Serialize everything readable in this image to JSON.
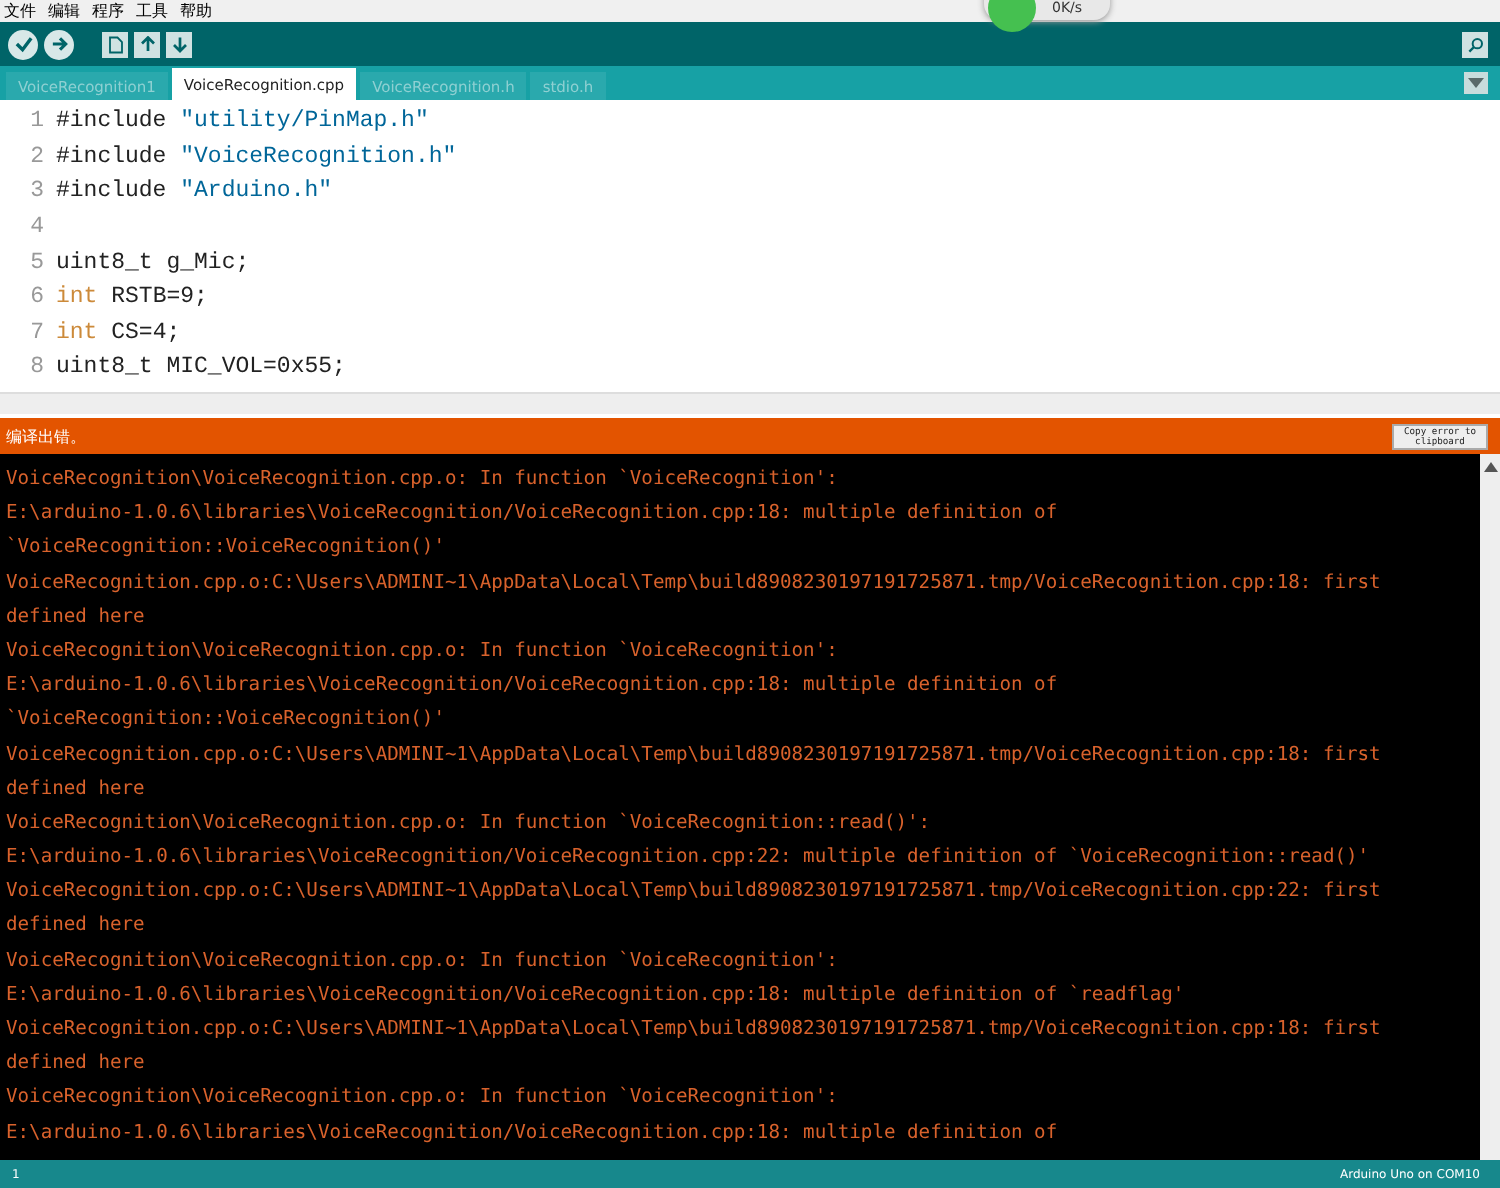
{
  "menu": [
    "文件",
    "编辑",
    "程序",
    "工具",
    "帮助"
  ],
  "speed_widget": {
    "reading": "0K/s"
  },
  "tabs": [
    {
      "label": "VoiceRecognition1",
      "selected": false
    },
    {
      "label": "VoiceRecognition.cpp",
      "selected": true
    },
    {
      "label": "VoiceRecognition.h",
      "selected": false
    },
    {
      "label": "stdio.h",
      "selected": false
    }
  ],
  "editor": {
    "lines": [
      {
        "number": "1",
        "tokens": [
          {
            "text": "#include ",
            "kind": "plain"
          },
          {
            "text": "\"utility/PinMap.h\"",
            "kind": "string"
          }
        ]
      },
      {
        "number": "2",
        "tokens": [
          {
            "text": "#include ",
            "kind": "plain"
          },
          {
            "text": "\"VoiceRecognition.h\"",
            "kind": "string"
          }
        ]
      },
      {
        "number": "3",
        "tokens": [
          {
            "text": "#include ",
            "kind": "plain"
          },
          {
            "text": "\"Arduino.h\"",
            "kind": "string"
          }
        ]
      },
      {
        "number": "4"
      },
      {
        "number": "5",
        "tokens": [
          {
            "text": "uint8_t g_Mic;",
            "kind": "plain"
          }
        ]
      },
      {
        "number": "6",
        "tokens": [
          {
            "text": "int",
            "kind": "keyword"
          },
          {
            "text": " RSTB=9;",
            "kind": "plain"
          }
        ]
      },
      {
        "number": "7",
        "tokens": [
          {
            "text": "int",
            "kind": "keyword"
          },
          {
            "text": " CS=4;",
            "kind": "plain"
          }
        ]
      },
      {
        "number": "8",
        "tokens": [
          {
            "text": "uint8_t MIC_VOL=0x55;",
            "kind": "plain"
          }
        ]
      }
    ]
  },
  "status": {
    "message": "编译出错。",
    "copy_button": "Copy error to clipboard"
  },
  "console": [
    "VoiceRecognition\\VoiceRecognition.cpp.o: In function `VoiceRecognition':",
    "E:\\arduino-1.0.6\\libraries\\VoiceRecognition/VoiceRecognition.cpp:18: multiple definition of",
    "`VoiceRecognition::VoiceRecognition()'",
    "VoiceRecognition.cpp.o:C:\\Users\\ADMINI~1\\AppData\\Local\\Temp\\build8908230197191725871.tmp/VoiceRecognition.cpp:18: first",
    "defined here",
    "VoiceRecognition\\VoiceRecognition.cpp.o: In function `VoiceRecognition':",
    "E:\\arduino-1.0.6\\libraries\\VoiceRecognition/VoiceRecognition.cpp:18: multiple definition of",
    "`VoiceRecognition::VoiceRecognition()'",
    "VoiceRecognition.cpp.o:C:\\Users\\ADMINI~1\\AppData\\Local\\Temp\\build8908230197191725871.tmp/VoiceRecognition.cpp:18: first",
    "defined here",
    "VoiceRecognition\\VoiceRecognition.cpp.o: In function `VoiceRecognition::read()':",
    "E:\\arduino-1.0.6\\libraries\\VoiceRecognition/VoiceRecognition.cpp:22: multiple definition of `VoiceRecognition::read()'",
    "VoiceRecognition.cpp.o:C:\\Users\\ADMINI~1\\AppData\\Local\\Temp\\build8908230197191725871.tmp/VoiceRecognition.cpp:22: first",
    "defined here",
    "VoiceRecognition\\VoiceRecognition.cpp.o: In function `VoiceRecognition':",
    "E:\\arduino-1.0.6\\libraries\\VoiceRecognition/VoiceRecognition.cpp:18: multiple definition of `readflag'",
    "VoiceRecognition.cpp.o:C:\\Users\\ADMINI~1\\AppData\\Local\\Temp\\build8908230197191725871.tmp/VoiceRecognition.cpp:18: first",
    "defined here",
    "VoiceRecognition\\VoiceRecognition.cpp.o: In function `VoiceRecognition':",
    "E:\\arduino-1.0.6\\libraries\\VoiceRecognition/VoiceRecognition.cpp:18: multiple definition of"
  ],
  "status_bar": {
    "line": "1",
    "board": "Arduino Uno on COM10"
  }
}
